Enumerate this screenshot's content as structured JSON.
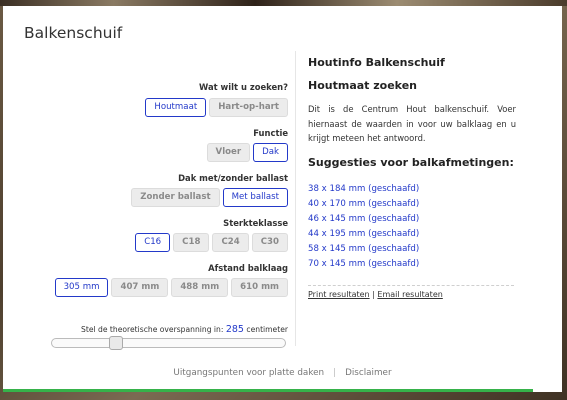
{
  "page_title": "Balkenschuif",
  "left": {
    "q1": {
      "label": "Wat wilt u zoeken?",
      "options": [
        "Houtmaat",
        "Hart-op-hart"
      ],
      "active": 0
    },
    "q2": {
      "label": "Functie",
      "options": [
        "Vloer",
        "Dak"
      ],
      "active": 1
    },
    "q3": {
      "label": "Dak met/zonder ballast",
      "options": [
        "Zonder ballast",
        "Met ballast"
      ],
      "active": 1
    },
    "q4": {
      "label": "Sterkteklasse",
      "options": [
        "C16",
        "C18",
        "C24",
        "C30"
      ],
      "active": 0
    },
    "q5": {
      "label": "Afstand balklaag",
      "options": [
        "305 mm",
        "407 mm",
        "488 mm",
        "610 mm"
      ],
      "active": 0
    },
    "slider": {
      "label_prefix": "Stel de theoretische overspanning in:",
      "value": "285",
      "unit": "centimeter",
      "fraction": 0.26
    }
  },
  "right": {
    "heading": "Houtinfo Balkenschuif",
    "subheading": "Houtmaat zoeken",
    "intro": "Dit is de Centrum Hout balkenschuif. Voer hiernaast de waarden in voor uw balklaag en u krijgt meteen het antwoord.",
    "suggestions_heading": "Suggesties voor balkafmetingen:",
    "suggestions": [
      "38 x 184 mm (geschaafd)",
      "40 x 170 mm (geschaafd)",
      "46 x 145 mm (geschaafd)",
      "44 x 195 mm (geschaafd)",
      "58 x 145 mm (geschaafd)",
      "70 x 145 mm (geschaafd)"
    ],
    "print_link": "Print resultaten",
    "results_sep": "|",
    "email_link": "Email resultaten"
  },
  "footer": {
    "link1": "Uitgangspunten voor platte daken",
    "divider": "|",
    "link2": "Disclaimer"
  },
  "colors": {
    "accent": "#2339c9",
    "green_bar": "#36b24a"
  }
}
